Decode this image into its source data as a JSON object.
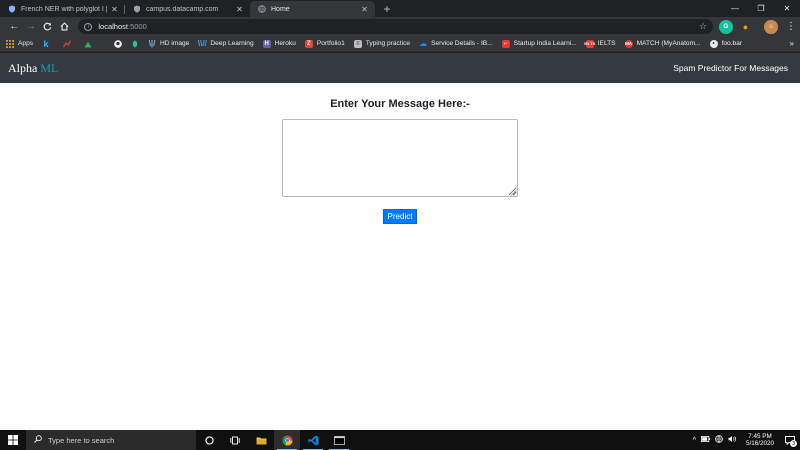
{
  "browser": {
    "tabs": [
      {
        "title": "French NER with polyglot I | Python",
        "favicon": "shield-icon",
        "active": false
      },
      {
        "title": "campus.datacamp.com",
        "favicon": "shield-icon",
        "active": false
      },
      {
        "title": "Home",
        "favicon": "globe-icon",
        "active": true
      }
    ],
    "new_tab_label": "+",
    "address": {
      "host": "localhost",
      "port": ":5000"
    },
    "bookmarks": [
      {
        "label": "Apps",
        "icon": "apps-grid-icon",
        "color": "#e8eaed"
      },
      {
        "label": "",
        "icon": "k-icon",
        "color": "#1a73e8"
      },
      {
        "label": "",
        "icon": "chart-icon",
        "color": "#ea4335"
      },
      {
        "label": "",
        "icon": "mountain-icon",
        "color": "#34a853"
      },
      {
        "label": "",
        "icon": "github-icon",
        "color": "#ffffff"
      },
      {
        "label": "",
        "icon": "leaf-icon",
        "color": "#20c997"
      },
      {
        "label": "HD image",
        "icon": "hd-icon",
        "color": "#4285f4"
      },
      {
        "label": "Deep Learning",
        "icon": "coursera-icon",
        "color": "#4aa3df"
      },
      {
        "label": "Heroku",
        "icon": "heroku-icon",
        "color": "#6762a6"
      },
      {
        "label": "Portfolio1",
        "icon": "portfolio-icon",
        "color": "#ea4335"
      },
      {
        "label": "Typing practice",
        "icon": "page-icon",
        "color": "#bdbdbd"
      },
      {
        "label": "Service Details - IB...",
        "icon": "cloud-icon",
        "color": "#1e88e5"
      },
      {
        "label": "Startup India Learni...",
        "icon": "startup-icon",
        "color": "#e53935"
      },
      {
        "label": "IELTS",
        "icon": "ielts-icon",
        "color": "#e53935"
      },
      {
        "label": "MATCH (MyAnatom...",
        "icon": "match-icon",
        "color": "#e53935"
      },
      {
        "label": "foo.bar",
        "icon": "foobar-icon",
        "color": "#e8eaed"
      }
    ],
    "more_bookmarks": "»"
  },
  "app": {
    "brand_main": "Alpha ",
    "brand_accent": "ML",
    "nav_title": "Spam Predictor For Messages",
    "heading": "Enter Your Message Here:-",
    "message_value": "",
    "predict_label": "Predict",
    "colors": {
      "navbar": "#343a40",
      "accent": "#17a2b8",
      "button": "#007bff"
    }
  },
  "taskbar": {
    "search_placeholder": "Type here to search",
    "time": "7:45 PM",
    "date": "5/16/2020",
    "notification_count": "3"
  }
}
